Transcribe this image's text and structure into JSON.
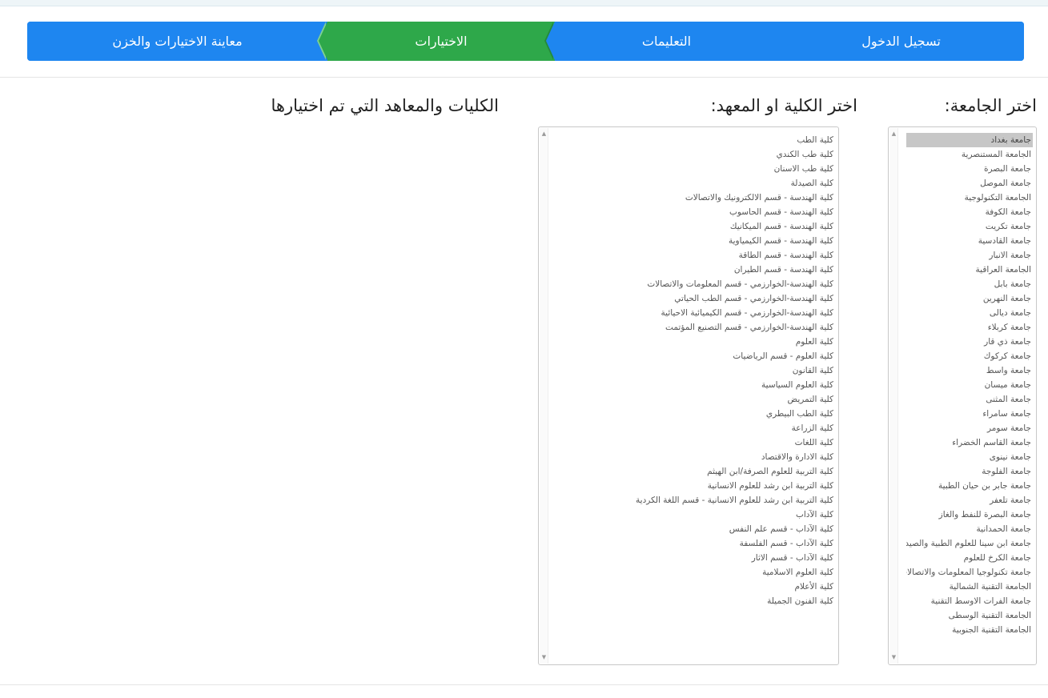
{
  "steps": [
    {
      "label": "تسجيل الدخول",
      "active": false
    },
    {
      "label": "التعليمات",
      "active": false
    },
    {
      "label": "الاختيارات",
      "active": true
    },
    {
      "label": "معاينة الاختيارات والخزن",
      "active": false
    }
  ],
  "colors": {
    "step_bg": "#1e86f0",
    "step_active_bg": "#2ea84a",
    "selected_option_bg": "#c7c7c7"
  },
  "titles": {
    "university": "اختر الجامعة:",
    "college": "اختر الكلية او المعهد:",
    "selected": "الكليات والمعاهد التي تم اختيارها"
  },
  "universities": {
    "selected_index": 0,
    "options": [
      "جامعة بغداد",
      "الجامعة المستنصرية",
      "جامعة البصرة",
      "جامعة الموصل",
      "الجامعة التكنولوجية",
      "جامعة الكوفة",
      "جامعة تكريت",
      "جامعة القادسية",
      "جامعة الانبار",
      "الجامعة العراقية",
      "جامعة بابل",
      "جامعة النهرين",
      "جامعة ديالى",
      "جامعة كربلاء",
      "جامعة ذي قار",
      "جامعة كركوك",
      "جامعة واسط",
      "جامعة ميسان",
      "جامعة المثنى",
      "جامعة سامراء",
      "جامعة سومر",
      "جامعة القاسم الخضراء",
      "جامعة نينوى",
      "جامعة الفلوجة",
      "جامعة جابر بن حيان الطبية",
      "جامعة تلعفر",
      "جامعة البصرة للنفط والغاز",
      "جامعة الحمدانية",
      "جامعة ابن سينا للعلوم الطبية والصيدلا",
      "جامعة الكرخ للعلوم",
      "جامعة تكنولوجيا المعلومات والاتصالات",
      "الجامعة التقنية الشمالية",
      "جامعة الفرات الاوسط التقنية",
      "الجامعة التقنية الوسطى",
      "الجامعة التقنية الجنوبية"
    ]
  },
  "colleges": {
    "options": [
      "كلية الطب",
      "كلية طب الكندي",
      "كلية طب الاسنان",
      "كلية الصيدلة",
      "كلية الهندسة - قسم الالكترونيك والاتصالات",
      "كلية الهندسة - قسم الحاسوب",
      "كلية الهندسة - قسم الميكانيك",
      "كلية الهندسة - قسم الكيمياوية",
      "كلية الهندسة - قسم الطاقة",
      "كلية الهندسة - قسم الطيران",
      "كلية الهندسة-الخوارزمي - قسم المعلومات والاتصالات",
      "كلية الهندسة-الخوارزمي - قسم الطب الحياتي",
      "كلية الهندسة-الخوارزمي - قسم الكيميائية الاحيائية",
      "كلية الهندسة-الخوارزمي - قسم التصنيع المؤتمت",
      "كلية العلوم",
      "كلية العلوم - قسم الرياضيات",
      "كلية القانون",
      "كلية العلوم السياسية",
      "كلية التمريض",
      "كلية الطب البيطري",
      "كلية الزراعة",
      "كلية اللغات",
      "كلية الادارة والاقتصاد",
      "كلية التربية للعلوم الصرفة/ابن الهيثم",
      "كلية التربية ابن رشد للعلوم الانسانية",
      "كلية التربية ابن رشد للعلوم الانسانية - قسم اللغة الكردية",
      "كلية الآداب",
      "كلية الآداب - قسم علم النفس",
      "كلية الآداب - قسم الفلسفة",
      "كلية الآداب - قسم الاثار",
      "كلية العلوم الاسلامية",
      "كلية الأعلام",
      "كلية الفنون الجميلة"
    ]
  },
  "icons": {
    "scroll_up": "▲",
    "scroll_down": "▼"
  }
}
